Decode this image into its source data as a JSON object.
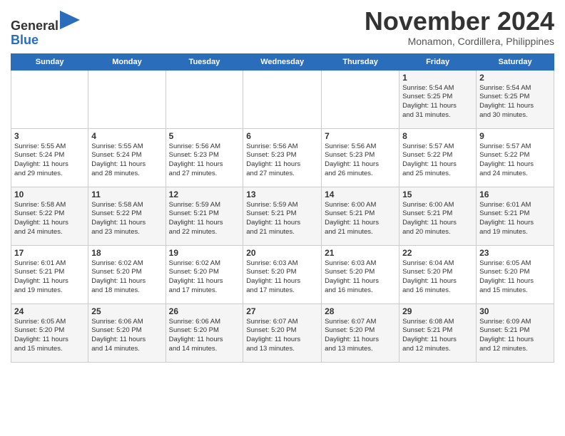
{
  "header": {
    "logo_line1": "General",
    "logo_line2": "Blue",
    "month": "November 2024",
    "location": "Monamon, Cordillera, Philippines"
  },
  "weekdays": [
    "Sunday",
    "Monday",
    "Tuesday",
    "Wednesday",
    "Thursday",
    "Friday",
    "Saturday"
  ],
  "weeks": [
    [
      {
        "day": "",
        "info": ""
      },
      {
        "day": "",
        "info": ""
      },
      {
        "day": "",
        "info": ""
      },
      {
        "day": "",
        "info": ""
      },
      {
        "day": "",
        "info": ""
      },
      {
        "day": "1",
        "info": "Sunrise: 5:54 AM\nSunset: 5:25 PM\nDaylight: 11 hours\nand 31 minutes."
      },
      {
        "day": "2",
        "info": "Sunrise: 5:54 AM\nSunset: 5:25 PM\nDaylight: 11 hours\nand 30 minutes."
      }
    ],
    [
      {
        "day": "3",
        "info": "Sunrise: 5:55 AM\nSunset: 5:24 PM\nDaylight: 11 hours\nand 29 minutes."
      },
      {
        "day": "4",
        "info": "Sunrise: 5:55 AM\nSunset: 5:24 PM\nDaylight: 11 hours\nand 28 minutes."
      },
      {
        "day": "5",
        "info": "Sunrise: 5:56 AM\nSunset: 5:23 PM\nDaylight: 11 hours\nand 27 minutes."
      },
      {
        "day": "6",
        "info": "Sunrise: 5:56 AM\nSunset: 5:23 PM\nDaylight: 11 hours\nand 27 minutes."
      },
      {
        "day": "7",
        "info": "Sunrise: 5:56 AM\nSunset: 5:23 PM\nDaylight: 11 hours\nand 26 minutes."
      },
      {
        "day": "8",
        "info": "Sunrise: 5:57 AM\nSunset: 5:22 PM\nDaylight: 11 hours\nand 25 minutes."
      },
      {
        "day": "9",
        "info": "Sunrise: 5:57 AM\nSunset: 5:22 PM\nDaylight: 11 hours\nand 24 minutes."
      }
    ],
    [
      {
        "day": "10",
        "info": "Sunrise: 5:58 AM\nSunset: 5:22 PM\nDaylight: 11 hours\nand 24 minutes."
      },
      {
        "day": "11",
        "info": "Sunrise: 5:58 AM\nSunset: 5:22 PM\nDaylight: 11 hours\nand 23 minutes."
      },
      {
        "day": "12",
        "info": "Sunrise: 5:59 AM\nSunset: 5:21 PM\nDaylight: 11 hours\nand 22 minutes."
      },
      {
        "day": "13",
        "info": "Sunrise: 5:59 AM\nSunset: 5:21 PM\nDaylight: 11 hours\nand 21 minutes."
      },
      {
        "day": "14",
        "info": "Sunrise: 6:00 AM\nSunset: 5:21 PM\nDaylight: 11 hours\nand 21 minutes."
      },
      {
        "day": "15",
        "info": "Sunrise: 6:00 AM\nSunset: 5:21 PM\nDaylight: 11 hours\nand 20 minutes."
      },
      {
        "day": "16",
        "info": "Sunrise: 6:01 AM\nSunset: 5:21 PM\nDaylight: 11 hours\nand 19 minutes."
      }
    ],
    [
      {
        "day": "17",
        "info": "Sunrise: 6:01 AM\nSunset: 5:21 PM\nDaylight: 11 hours\nand 19 minutes."
      },
      {
        "day": "18",
        "info": "Sunrise: 6:02 AM\nSunset: 5:20 PM\nDaylight: 11 hours\nand 18 minutes."
      },
      {
        "day": "19",
        "info": "Sunrise: 6:02 AM\nSunset: 5:20 PM\nDaylight: 11 hours\nand 17 minutes."
      },
      {
        "day": "20",
        "info": "Sunrise: 6:03 AM\nSunset: 5:20 PM\nDaylight: 11 hours\nand 17 minutes."
      },
      {
        "day": "21",
        "info": "Sunrise: 6:03 AM\nSunset: 5:20 PM\nDaylight: 11 hours\nand 16 minutes."
      },
      {
        "day": "22",
        "info": "Sunrise: 6:04 AM\nSunset: 5:20 PM\nDaylight: 11 hours\nand 16 minutes."
      },
      {
        "day": "23",
        "info": "Sunrise: 6:05 AM\nSunset: 5:20 PM\nDaylight: 11 hours\nand 15 minutes."
      }
    ],
    [
      {
        "day": "24",
        "info": "Sunrise: 6:05 AM\nSunset: 5:20 PM\nDaylight: 11 hours\nand 15 minutes."
      },
      {
        "day": "25",
        "info": "Sunrise: 6:06 AM\nSunset: 5:20 PM\nDaylight: 11 hours\nand 14 minutes."
      },
      {
        "day": "26",
        "info": "Sunrise: 6:06 AM\nSunset: 5:20 PM\nDaylight: 11 hours\nand 14 minutes."
      },
      {
        "day": "27",
        "info": "Sunrise: 6:07 AM\nSunset: 5:20 PM\nDaylight: 11 hours\nand 13 minutes."
      },
      {
        "day": "28",
        "info": "Sunrise: 6:07 AM\nSunset: 5:20 PM\nDaylight: 11 hours\nand 13 minutes."
      },
      {
        "day": "29",
        "info": "Sunrise: 6:08 AM\nSunset: 5:21 PM\nDaylight: 11 hours\nand 12 minutes."
      },
      {
        "day": "30",
        "info": "Sunrise: 6:09 AM\nSunset: 5:21 PM\nDaylight: 11 hours\nand 12 minutes."
      }
    ]
  ]
}
